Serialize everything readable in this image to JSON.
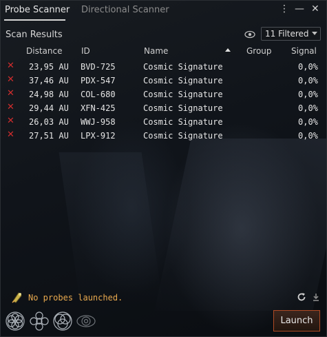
{
  "tabs": [
    {
      "label": "Probe Scanner",
      "active": true
    },
    {
      "label": "Directional Scanner",
      "active": false
    }
  ],
  "window_controls": {
    "menu": "⋮",
    "minimize": "—",
    "close": "✕"
  },
  "scan_results": {
    "title": "Scan Results",
    "filter": {
      "selected": "11 Filtered"
    },
    "columns": [
      "Distance",
      "ID",
      "Name",
      "Group",
      "Signal"
    ],
    "sorted_column": "Name",
    "rows": [
      {
        "distance": "23,95 AU",
        "id": "BVD-725",
        "name": "Cosmic Signature",
        "group": "",
        "signal": "0,0%"
      },
      {
        "distance": "37,46 AU",
        "id": "PDX-547",
        "name": "Cosmic Signature",
        "group": "",
        "signal": "0,0%"
      },
      {
        "distance": "24,98 AU",
        "id": "COL-680",
        "name": "Cosmic Signature",
        "group": "",
        "signal": "0,0%"
      },
      {
        "distance": "29,44 AU",
        "id": "XFN-425",
        "name": "Cosmic Signature",
        "group": "",
        "signal": "0,0%"
      },
      {
        "distance": "26,03 AU",
        "id": "WWJ-958",
        "name": "Cosmic Signature",
        "group": "",
        "signal": "0,0%"
      },
      {
        "distance": "27,51 AU",
        "id": "LPX-912",
        "name": "Cosmic Signature",
        "group": "",
        "signal": "0,0%"
      }
    ]
  },
  "status": {
    "probes": "No probes launched."
  },
  "launch": {
    "label": "Launch"
  },
  "colors": {
    "accent": "#d12d2d",
    "warning": "#e9a94e",
    "launch_border": "#b04a24"
  },
  "icons": [
    "eye-icon",
    "probe-icon",
    "refresh-icon",
    "download-icon",
    "formation-icon"
  ]
}
